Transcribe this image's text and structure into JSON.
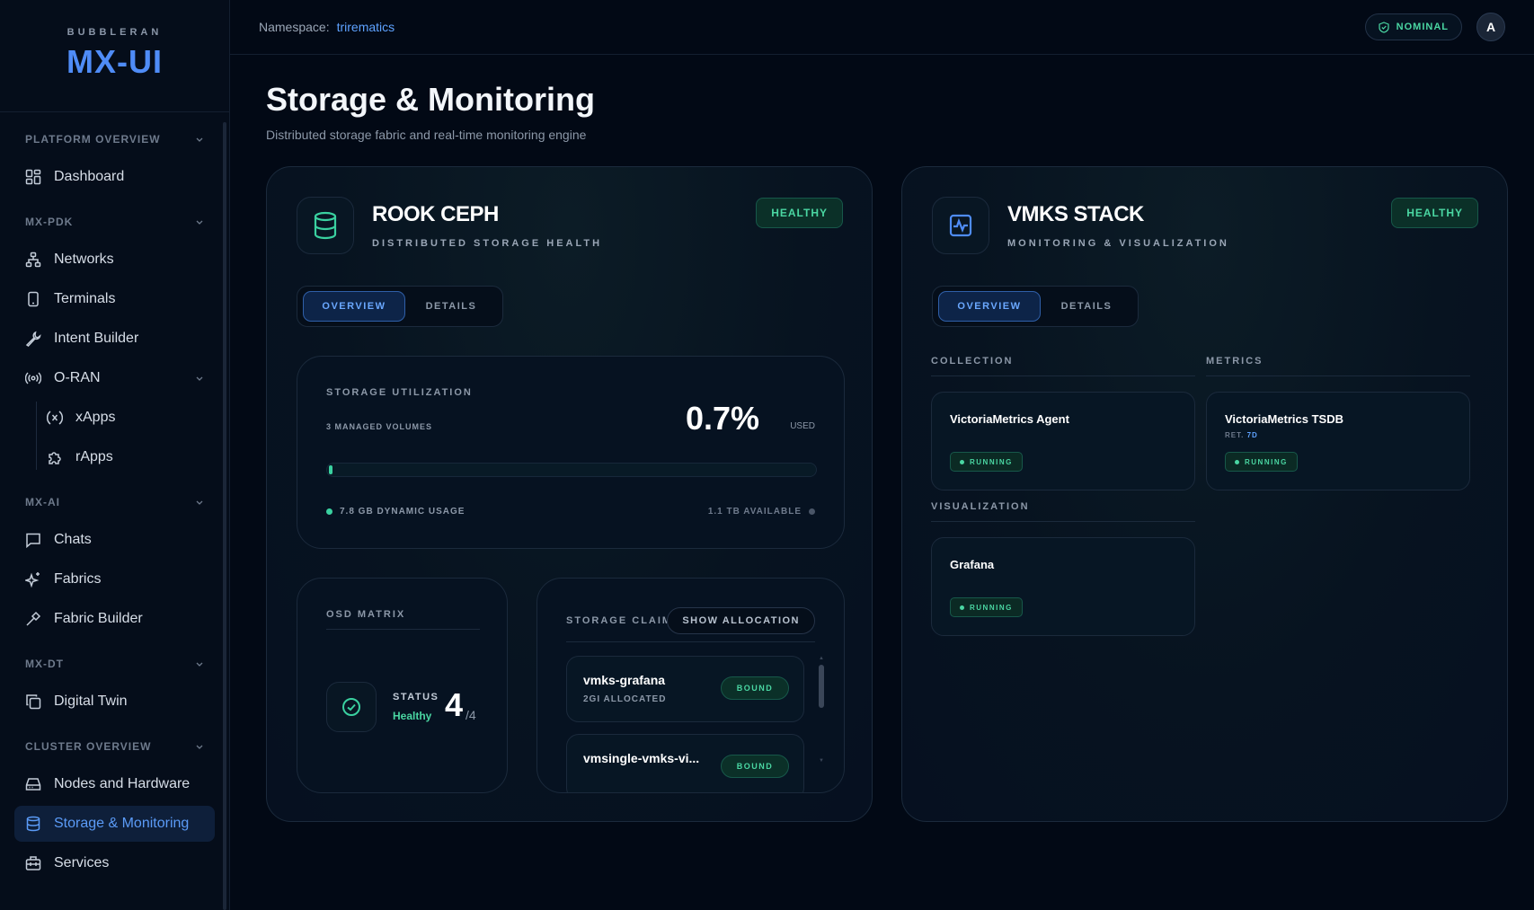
{
  "brand": {
    "sub": "BUBBLERAN",
    "title": "MX-UI"
  },
  "header": {
    "namespace_label": "Namespace:",
    "namespace_value": "trirematics",
    "status": "NOMINAL",
    "avatar": "A"
  },
  "sidebar": {
    "sections": [
      {
        "label": "PLATFORM OVERVIEW",
        "items": [
          {
            "label": "Dashboard",
            "icon": "dashboard-icon"
          }
        ]
      },
      {
        "label": "MX-PDK",
        "items": [
          {
            "label": "Networks",
            "icon": "network-icon"
          },
          {
            "label": "Terminals",
            "icon": "terminal-icon"
          },
          {
            "label": "Intent Builder",
            "icon": "wrench-icon"
          },
          {
            "label": "O-RAN",
            "icon": "radio-icon"
          },
          {
            "label": "xApps",
            "icon": "xapp-icon"
          },
          {
            "label": "rApps",
            "icon": "puzzle-icon"
          }
        ]
      },
      {
        "label": "MX-AI",
        "items": [
          {
            "label": "Chats",
            "icon": "chat-icon"
          },
          {
            "label": "Fabrics",
            "icon": "sparkle-icon"
          },
          {
            "label": "Fabric Builder",
            "icon": "hammer-icon"
          }
        ]
      },
      {
        "label": "MX-DT",
        "items": [
          {
            "label": "Digital Twin",
            "icon": "copy-icon"
          }
        ]
      },
      {
        "label": "CLUSTER OVERVIEW",
        "items": [
          {
            "label": "Nodes and Hardware",
            "icon": "hard-drive-icon"
          },
          {
            "label": "Storage & Monitoring",
            "icon": "database-icon"
          },
          {
            "label": "Services",
            "icon": "services-icon"
          }
        ]
      }
    ]
  },
  "page": {
    "title": "Storage & Monitoring",
    "subtitle": "Distributed storage fabric and real-time monitoring engine"
  },
  "rook": {
    "title": "ROOK CEPH",
    "subtitle": "DISTRIBUTED STORAGE HEALTH",
    "status": "HEALTHY",
    "tabs": [
      "OVERVIEW",
      "DETAILS"
    ],
    "utilization": {
      "label": "STORAGE UTILIZATION",
      "volumes": "3 MANAGED VOLUMES",
      "percent": "0.7%",
      "used_label": "USED",
      "fill_fraction": 0.007,
      "dynamic": "7.8 GB DYNAMIC USAGE",
      "available": "1.1 TB AVAILABLE"
    },
    "osd": {
      "label": "OSD MATRIX",
      "status_label": "STATUS",
      "status_value": "Healthy",
      "up": "4",
      "total": "/4"
    },
    "claims": {
      "label": "STORAGE CLAIMS",
      "button": "SHOW ALLOCATION",
      "items": [
        {
          "name": "vmks-grafana",
          "alloc": "2GI ALLOCATED",
          "status": "BOUND"
        },
        {
          "name": "vmsingle-vmks-vi...",
          "alloc": "",
          "status": "BOUND"
        }
      ]
    }
  },
  "vmks": {
    "title": "VMKS STACK",
    "subtitle": "MONITORING & VISUALIZATION",
    "status": "HEALTHY",
    "tabs": [
      "OVERVIEW",
      "DETAILS"
    ],
    "collection_label": "COLLECTION",
    "metrics_label": "METRICS",
    "visualization_label": "VISUALIZATION",
    "agent": {
      "name": "VictoriaMetrics Agent",
      "status": "RUNNING"
    },
    "tsdb": {
      "name": "VictoriaMetrics TSDB",
      "ret_label": "RET.",
      "ret_value": "7D",
      "status": "RUNNING"
    },
    "grafana": {
      "name": "Grafana",
      "status": "RUNNING"
    }
  },
  "colors": {
    "accent": "#4f8cf7",
    "healthy": "#4ad6a2",
    "background": "#020915"
  }
}
